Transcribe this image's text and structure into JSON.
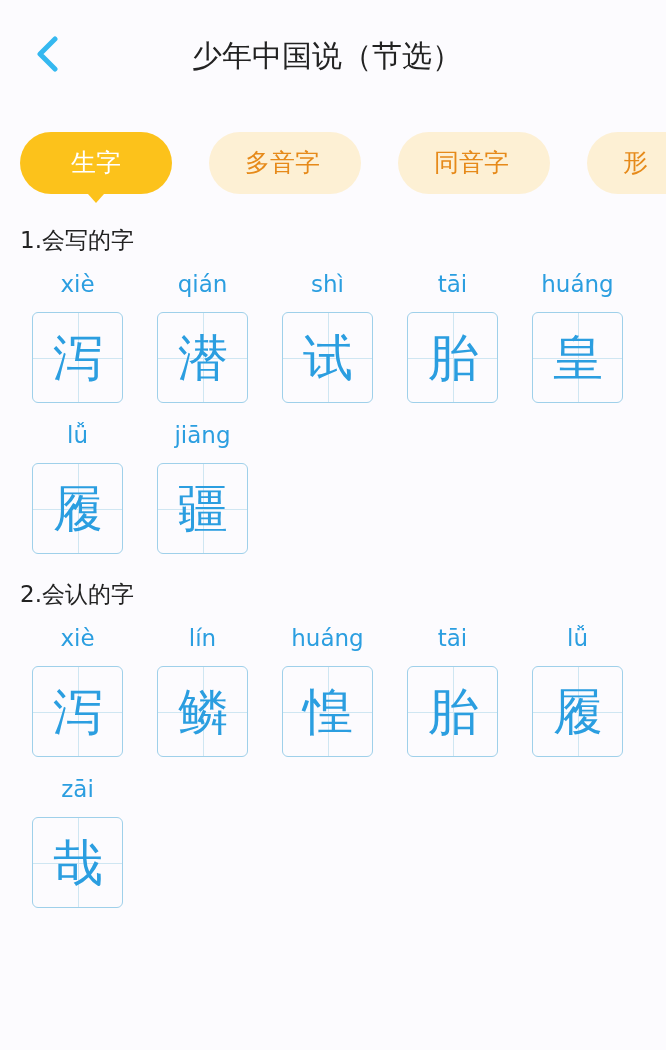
{
  "header": {
    "title": "少年中国说（节选）"
  },
  "tabs": [
    {
      "label": "生字",
      "selected": true
    },
    {
      "label": "多音字",
      "selected": false
    },
    {
      "label": "同音字",
      "selected": false
    },
    {
      "label": "形",
      "selected": false
    }
  ],
  "sections": [
    {
      "title": "1.会写的字",
      "chars": [
        {
          "pinyin": "xiè",
          "char": "泻"
        },
        {
          "pinyin": "qián",
          "char": "潜"
        },
        {
          "pinyin": "shì",
          "char": "试"
        },
        {
          "pinyin": "tāi",
          "char": "胎"
        },
        {
          "pinyin": "huáng",
          "char": "皇"
        },
        {
          "pinyin": "lǚ",
          "char": "履"
        },
        {
          "pinyin": "jiāng",
          "char": "疆"
        }
      ]
    },
    {
      "title": "2.会认的字",
      "chars": [
        {
          "pinyin": "xiè",
          "char": "泻"
        },
        {
          "pinyin": "lín",
          "char": "鳞"
        },
        {
          "pinyin": "huáng",
          "char": "惶"
        },
        {
          "pinyin": "tāi",
          "char": "胎"
        },
        {
          "pinyin": "lǚ",
          "char": "履"
        },
        {
          "pinyin": "zāi",
          "char": "哉"
        }
      ]
    }
  ]
}
